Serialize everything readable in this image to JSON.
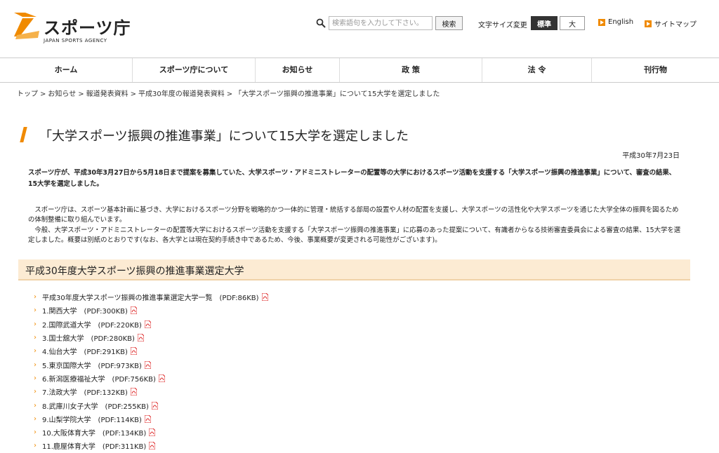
{
  "header": {
    "logo_text": "スポーツ庁",
    "logo_subtext": "JAPAN SPORTS AGENCY",
    "search_placeholder": "検索語句を入力して下さい。",
    "search_button": "検索",
    "fontsize_label": "文字サイズ変更",
    "fontsize_standard": "標準",
    "fontsize_large": "大",
    "english_link": "English",
    "sitemap_link": "サイトマップ",
    "accent_color": "#f08a00"
  },
  "nav": {
    "items": [
      {
        "label": "ホーム"
      },
      {
        "label": "スポーツ庁について"
      },
      {
        "label": "お知らせ"
      },
      {
        "label": "政 策"
      },
      {
        "label": "法 令"
      },
      {
        "label": "刊行物"
      }
    ]
  },
  "breadcrumb": {
    "items": [
      "トップ",
      "お知らせ",
      "報道発表資料",
      "平成30年度の報道発表資料",
      "「大学スポーツ振興の推進事業」について15大学を選定しました"
    ],
    "separator": ">"
  },
  "page": {
    "title": "「大学スポーツ振興の推進事業」について15大学を選定しました",
    "date": "平成30年7月23日",
    "lead": "スポーツ庁が、平成30年3月27日から5月18日まで提案を募集していた、大学スポーツ・アドミニストレーターの配置等の大学におけるスポーツ活動を支援する「大学スポーツ振興の推進事業」について、審査の結果、15大学を選定しました。",
    "body1": "スポーツ庁は、スポーツ基本計画に基づき、大学におけるスポーツ分野を戦略的かつ一体的に管理・統括する部局の設置や人材の配置を支援し、大学スポーツの活性化や大学スポーツを通じた大学全体の振興を図るための体制整備に取り組んでいます。",
    "body2": "今般、大学スポーツ・アドミニストレーターの配置等大学におけるスポーツ活動を支援する「大学スポーツ振興の推進事業」に応募のあった提案について、有識者からなる技術審査委員会による審査の結果、15大学を選定しました。概要は別紙のとおりです(なお、各大学とは現在契約手続き中であるため、今後、事業概要が変更される可能性がございます)。",
    "section_title": "平成30年度大学スポーツ振興の推進事業選定大学"
  },
  "files": [
    {
      "label": "平成30年度大学スポーツ振興の推進事業選定大学一覧　(PDF:86KB)"
    },
    {
      "label": "1.関西大学　(PDF:300KB)"
    },
    {
      "label": "2.国際武道大学　(PDF:220KB)"
    },
    {
      "label": "3.国士舘大学　(PDF:280KB)"
    },
    {
      "label": "4.仙台大学　(PDF:291KB)"
    },
    {
      "label": "5.東京国際大学　(PDF:973KB)"
    },
    {
      "label": "6.新潟医療福祉大学　(PDF:756KB)"
    },
    {
      "label": "7.法政大学　(PDF:132KB)"
    },
    {
      "label": "8.武庫川女子大学　(PDF:255KB)"
    },
    {
      "label": "9.山梨学院大学　(PDF:114KB)"
    },
    {
      "label": "10.大阪体育大学　(PDF:134KB)"
    },
    {
      "label": "11.鹿屋体育大学　(PDF:311KB)"
    }
  ]
}
